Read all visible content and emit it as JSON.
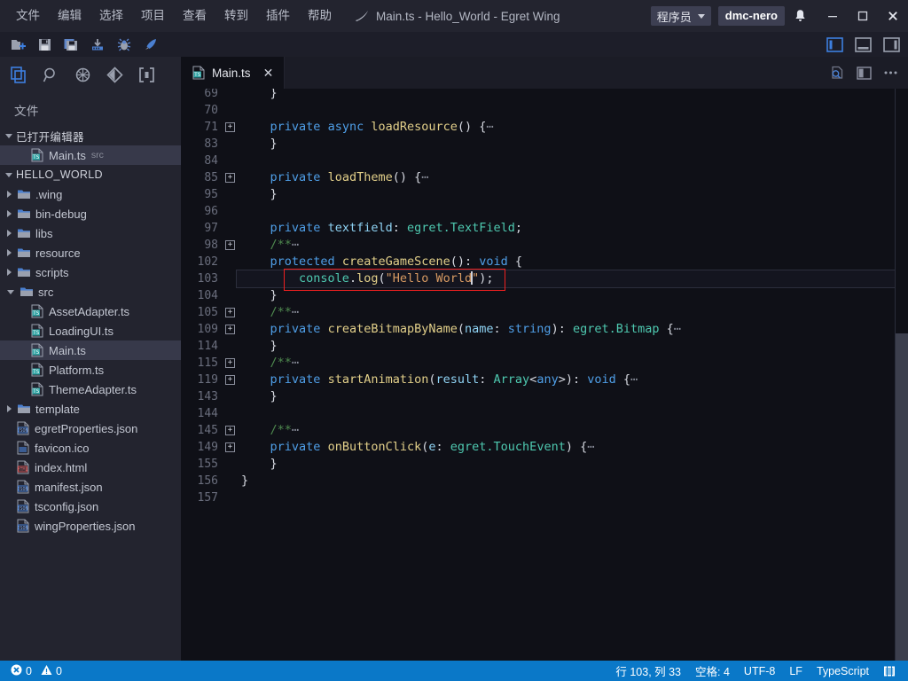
{
  "titlebar": {
    "menu": [
      "文件",
      "编辑",
      "选择",
      "项目",
      "查看",
      "转到",
      "插件",
      "帮助"
    ],
    "window_title": "Main.ts - Hello_World - Egret Wing",
    "logo_icon": "egret-wing-logo-icon",
    "role_select": {
      "value": "程序员",
      "icon": "chevron-down-icon"
    },
    "user_badge": "dmc-nero",
    "bell_icon": "bell-icon",
    "window_controls": {
      "minimize": "minimize-icon",
      "maximize": "maximize-icon",
      "close": "close-icon"
    }
  },
  "toolbar": {
    "buttons": [
      {
        "name": "new-folder-icon",
        "title": "新建文件夹"
      },
      {
        "name": "save-icon",
        "title": "保存"
      },
      {
        "name": "save-all-icon",
        "title": "全部保存"
      },
      {
        "name": "install-icon",
        "title": "安装"
      },
      {
        "name": "debug-icon",
        "title": "调试"
      },
      {
        "name": "run-icon",
        "title": "运行"
      }
    ],
    "layout_toggles": [
      {
        "name": "toggle-sidebar-icon",
        "active": true
      },
      {
        "name": "toggle-panel-icon",
        "active": false
      },
      {
        "name": "toggle-right-sidebar-icon",
        "active": false
      }
    ]
  },
  "activitybar": {
    "items": [
      {
        "name": "explorer-icon",
        "active": true
      },
      {
        "name": "search-icon",
        "active": false
      },
      {
        "name": "debug-icon",
        "active": false
      },
      {
        "name": "source-control-icon",
        "active": false
      },
      {
        "name": "extensions-icon",
        "active": false
      }
    ]
  },
  "sidebar": {
    "title": "文件",
    "open_editors": {
      "label": "已打开编辑器",
      "expanded": true,
      "items": [
        {
          "label": "Main.ts",
          "sublabel": "src",
          "icon": "typescript-file-icon",
          "selected": true
        }
      ]
    },
    "project": {
      "label": "HELLO_WORLD",
      "expanded": true,
      "items": [
        {
          "label": ".wing",
          "type": "folder",
          "expanded": false,
          "indent": 1
        },
        {
          "label": "bin-debug",
          "type": "folder",
          "expanded": false,
          "indent": 1
        },
        {
          "label": "libs",
          "type": "folder",
          "expanded": false,
          "indent": 1
        },
        {
          "label": "resource",
          "type": "folder",
          "expanded": false,
          "indent": 1
        },
        {
          "label": "scripts",
          "type": "folder",
          "expanded": false,
          "indent": 1
        },
        {
          "label": "src",
          "type": "folder",
          "expanded": true,
          "indent": 1
        },
        {
          "label": "AssetAdapter.ts",
          "type": "ts",
          "indent": 2
        },
        {
          "label": "LoadingUI.ts",
          "type": "ts",
          "indent": 2
        },
        {
          "label": "Main.ts",
          "type": "ts",
          "indent": 2,
          "selected": true
        },
        {
          "label": "Platform.ts",
          "type": "ts",
          "indent": 2
        },
        {
          "label": "ThemeAdapter.ts",
          "type": "ts",
          "indent": 2
        },
        {
          "label": "template",
          "type": "folder",
          "expanded": false,
          "indent": 1
        },
        {
          "label": "egretProperties.json",
          "type": "json",
          "indent": 1
        },
        {
          "label": "favicon.ico",
          "type": "ico",
          "indent": 1
        },
        {
          "label": "index.html",
          "type": "html",
          "indent": 1
        },
        {
          "label": "manifest.json",
          "type": "json",
          "indent": 1
        },
        {
          "label": "tsconfig.json",
          "type": "json",
          "indent": 1
        },
        {
          "label": "wingProperties.json",
          "type": "json",
          "indent": 1
        }
      ]
    }
  },
  "editor": {
    "tabs": [
      {
        "label": "Main.ts",
        "icon": "typescript-file-icon",
        "active": true,
        "close_icon": "close-icon"
      }
    ],
    "actions": [
      {
        "name": "preview-icon"
      },
      {
        "name": "split-editor-icon"
      },
      {
        "name": "more-actions-icon",
        "label": "⋯"
      }
    ],
    "lines": [
      {
        "num": "69",
        "fold": false,
        "tokens": [
          {
            "t": "    }",
            "c": "pn"
          }
        ],
        "clipped": true
      },
      {
        "num": "70",
        "fold": false,
        "tokens": []
      },
      {
        "num": "71",
        "fold": true,
        "tokens": [
          {
            "t": "    ",
            "c": "pl"
          },
          {
            "t": "private",
            "c": "kw"
          },
          {
            "t": " ",
            "c": "pl"
          },
          {
            "t": "async",
            "c": "kw"
          },
          {
            "t": " ",
            "c": "pl"
          },
          {
            "t": "loadResource",
            "c": "fn"
          },
          {
            "t": "() {",
            "c": "pn"
          },
          {
            "t": "⋯",
            "c": "dots"
          }
        ]
      },
      {
        "num": "83",
        "fold": false,
        "tokens": [
          {
            "t": "    }",
            "c": "pn"
          }
        ]
      },
      {
        "num": "84",
        "fold": false,
        "tokens": []
      },
      {
        "num": "85",
        "fold": true,
        "tokens": [
          {
            "t": "    ",
            "c": "pl"
          },
          {
            "t": "private",
            "c": "kw"
          },
          {
            "t": " ",
            "c": "pl"
          },
          {
            "t": "loadTheme",
            "c": "fn"
          },
          {
            "t": "() {",
            "c": "pn"
          },
          {
            "t": "⋯",
            "c": "dots"
          }
        ]
      },
      {
        "num": "95",
        "fold": false,
        "tokens": [
          {
            "t": "    }",
            "c": "pn"
          }
        ]
      },
      {
        "num": "96",
        "fold": false,
        "tokens": []
      },
      {
        "num": "97",
        "fold": false,
        "tokens": [
          {
            "t": "    ",
            "c": "pl"
          },
          {
            "t": "private",
            "c": "kw"
          },
          {
            "t": " ",
            "c": "pl"
          },
          {
            "t": "textfield",
            "c": "var"
          },
          {
            "t": ": ",
            "c": "pn"
          },
          {
            "t": "egret.TextField",
            "c": "ty"
          },
          {
            "t": ";",
            "c": "pn"
          }
        ]
      },
      {
        "num": "98",
        "fold": true,
        "tokens": [
          {
            "t": "    ",
            "c": "pl"
          },
          {
            "t": "/**",
            "c": "cm"
          },
          {
            "t": "⋯",
            "c": "dots"
          }
        ]
      },
      {
        "num": "102",
        "fold": false,
        "tokens": [
          {
            "t": "    ",
            "c": "pl"
          },
          {
            "t": "protected",
            "c": "kw"
          },
          {
            "t": " ",
            "c": "pl"
          },
          {
            "t": "createGameScene",
            "c": "fn"
          },
          {
            "t": "(): ",
            "c": "pn"
          },
          {
            "t": "void",
            "c": "kw"
          },
          {
            "t": " {",
            "c": "pn"
          }
        ]
      },
      {
        "num": "103",
        "fold": false,
        "current": true,
        "tokens": [
          {
            "t": "        ",
            "c": "pl"
          },
          {
            "t": "console",
            "c": "ty"
          },
          {
            "t": ".",
            "c": "pn"
          },
          {
            "t": "log",
            "c": "fn"
          },
          {
            "t": "(",
            "c": "pn"
          },
          {
            "t": "\"Hello World",
            "c": "str"
          },
          {
            "t": "|CARET|",
            "c": "caret"
          },
          {
            "t": "\"",
            "c": "str"
          },
          {
            "t": ");",
            "c": "pn"
          }
        ]
      },
      {
        "num": "104",
        "fold": false,
        "tokens": [
          {
            "t": "    }",
            "c": "pn"
          }
        ]
      },
      {
        "num": "105",
        "fold": true,
        "tokens": [
          {
            "t": "    ",
            "c": "pl"
          },
          {
            "t": "/**",
            "c": "cm"
          },
          {
            "t": "⋯",
            "c": "dots"
          }
        ]
      },
      {
        "num": "109",
        "fold": true,
        "tokens": [
          {
            "t": "    ",
            "c": "pl"
          },
          {
            "t": "private",
            "c": "kw"
          },
          {
            "t": " ",
            "c": "pl"
          },
          {
            "t": "createBitmapByName",
            "c": "fn"
          },
          {
            "t": "(",
            "c": "pn"
          },
          {
            "t": "name",
            "c": "var"
          },
          {
            "t": ": ",
            "c": "pn"
          },
          {
            "t": "string",
            "c": "kw"
          },
          {
            "t": "): ",
            "c": "pn"
          },
          {
            "t": "egret.Bitmap",
            "c": "ty"
          },
          {
            "t": " {",
            "c": "pn"
          },
          {
            "t": "⋯",
            "c": "dots"
          }
        ]
      },
      {
        "num": "114",
        "fold": false,
        "tokens": [
          {
            "t": "    }",
            "c": "pn"
          }
        ]
      },
      {
        "num": "115",
        "fold": true,
        "tokens": [
          {
            "t": "    ",
            "c": "pl"
          },
          {
            "t": "/**",
            "c": "cm"
          },
          {
            "t": "⋯",
            "c": "dots"
          }
        ]
      },
      {
        "num": "119",
        "fold": true,
        "tokens": [
          {
            "t": "    ",
            "c": "pl"
          },
          {
            "t": "private",
            "c": "kw"
          },
          {
            "t": " ",
            "c": "pl"
          },
          {
            "t": "startAnimation",
            "c": "fn"
          },
          {
            "t": "(",
            "c": "pn"
          },
          {
            "t": "result",
            "c": "var"
          },
          {
            "t": ": ",
            "c": "pn"
          },
          {
            "t": "Array",
            "c": "ty"
          },
          {
            "t": "<",
            "c": "pn"
          },
          {
            "t": "any",
            "c": "kw"
          },
          {
            "t": ">): ",
            "c": "pn"
          },
          {
            "t": "void",
            "c": "kw"
          },
          {
            "t": " {",
            "c": "pn"
          },
          {
            "t": "⋯",
            "c": "dots"
          }
        ]
      },
      {
        "num": "143",
        "fold": false,
        "tokens": [
          {
            "t": "    }",
            "c": "pn"
          }
        ]
      },
      {
        "num": "144",
        "fold": false,
        "tokens": []
      },
      {
        "num": "145",
        "fold": true,
        "tokens": [
          {
            "t": "    ",
            "c": "pl"
          },
          {
            "t": "/**",
            "c": "cm"
          },
          {
            "t": "⋯",
            "c": "dots"
          }
        ]
      },
      {
        "num": "149",
        "fold": true,
        "tokens": [
          {
            "t": "    ",
            "c": "pl"
          },
          {
            "t": "private",
            "c": "kw"
          },
          {
            "t": " ",
            "c": "pl"
          },
          {
            "t": "onButtonClick",
            "c": "fn"
          },
          {
            "t": "(",
            "c": "pn"
          },
          {
            "t": "e",
            "c": "var"
          },
          {
            "t": ": ",
            "c": "pn"
          },
          {
            "t": "egret.TouchEvent",
            "c": "ty"
          },
          {
            "t": ") {",
            "c": "pn"
          },
          {
            "t": "⋯",
            "c": "dots"
          }
        ]
      },
      {
        "num": "155",
        "fold": false,
        "tokens": [
          {
            "t": "    }",
            "c": "pn"
          }
        ]
      },
      {
        "num": "156",
        "fold": false,
        "tokens": [
          {
            "t": "}",
            "c": "pn"
          }
        ]
      },
      {
        "num": "157",
        "fold": false,
        "tokens": []
      }
    ],
    "annotation": {
      "name": "red-highlight-box",
      "color": "#ef2020",
      "target_line": "103"
    }
  },
  "statusbar": {
    "errors": {
      "icon": "error-icon",
      "count": "0"
    },
    "warnings": {
      "icon": "warning-icon",
      "count": "0"
    },
    "cursor_position": "行 103, 列 33",
    "indentation": "空格: 4",
    "encoding": "UTF-8",
    "eol": "LF",
    "language": "TypeScript",
    "feedback_icon": "feedback-icon",
    "background": "#0a78c8"
  }
}
